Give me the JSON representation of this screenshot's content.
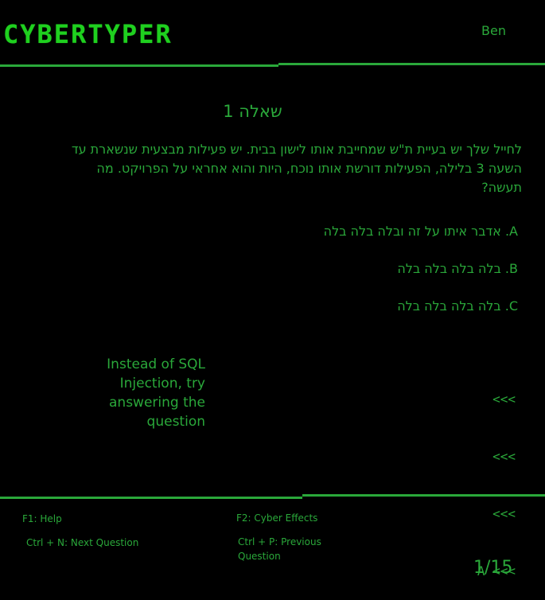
{
  "header": {
    "logo": "CYBERTYPER",
    "username": "Ben"
  },
  "question": {
    "title": "שאלה 1",
    "text": "לחייל שלך יש בעיית ת\"ש שמחייבת אותו לישון בבית. יש פעילות מבצעית שנשארת עד השעה 3 בלילה, הפעילות דורשת אותו נוכח, היות והוא אחראי על הפרויקט. מה תעשה?",
    "answers": [
      {
        "letter": "A",
        "text": "A. אדבר איתו על זה ובלה בלה בלה"
      },
      {
        "letter": "B",
        "text": "B. בלה בלה בלה בלה"
      },
      {
        "letter": "C",
        "text": "C. בלה בלה בלה בלה"
      }
    ]
  },
  "hint": {
    "text": "Instead of SQL Injection, try answering the question"
  },
  "prompt": {
    "lines": [
      "<<<",
      "<<<",
      "<<<",
      "A <<<"
    ]
  },
  "footer": {
    "help": "F1: Help",
    "effects": "F2: Cyber Effects",
    "next": "Ctrl + N: Next Question",
    "previous": "Ctrl + P: Previous Question",
    "progress": "1/15"
  },
  "colors": {
    "background": "#000000",
    "accent": "#2aa83a",
    "logo": "#1fd01f"
  }
}
